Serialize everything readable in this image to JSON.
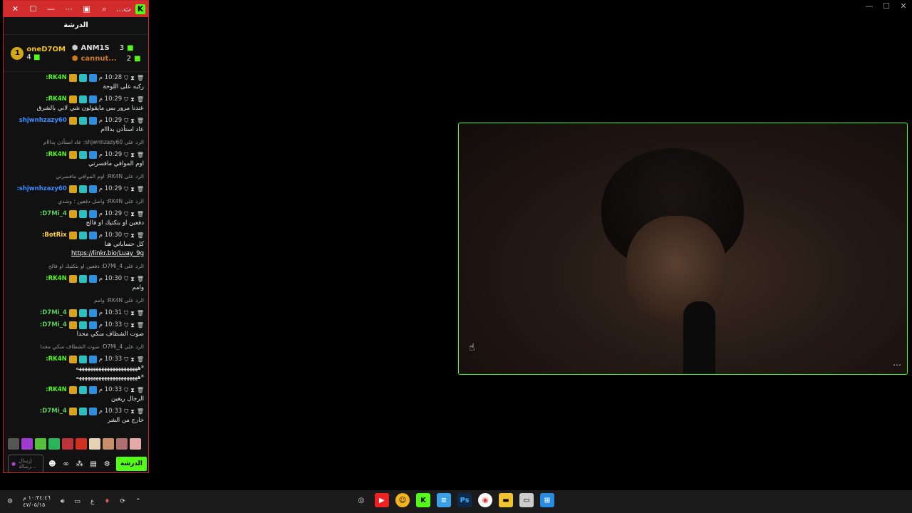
{
  "window_controls": [
    "—",
    "☐",
    "✕"
  ],
  "chat_window": {
    "title": "...ت",
    "header": "الدرشة",
    "leaderboard": {
      "first": {
        "rank": "1",
        "name": "oneD7OM",
        "count": "4"
      },
      "second": {
        "rank": "3",
        "name": "ANM1S"
      },
      "third": {
        "rank": "2",
        "name": "cannut..."
      }
    },
    "messages": [
      {
        "time": "10:28 م",
        "user": "RK4N:",
        "text": "ركبه على اللوحة",
        "ucls": "user-g"
      },
      {
        "time": "10:29 م",
        "user": "RK4N:",
        "text": "عندنا مرور بس مايقولون شي لاني بالشرق",
        "ucls": "user-g"
      },
      {
        "time": "10:29 م",
        "user": "shjwnhzazy60",
        "text": "عاد استأذن بدااام",
        "ucls": "user-b"
      },
      {
        "reply": "الرد على shjwnhzazy60: عاد استأذن بدااام"
      },
      {
        "time": "10:29 م",
        "user": "RK4N:",
        "text": "اوم الموافي مافسرتي",
        "ucls": "user-g"
      },
      {
        "reply": "الرد على RK4N: اوم الموافي مافسرتي"
      },
      {
        "time": "10:29 م",
        "user": "shjwnhzazy60:",
        "text": "",
        "ucls": "user-b"
      },
      {
        "reply": "الرد على RK4N: واصل دفعين ؛ وشدي"
      },
      {
        "time": "10:29 م",
        "user": "D7Mi_4:",
        "text": "دفعين او بتكتيك او فالح",
        "ucls": "user-gr"
      },
      {
        "time": "10:30 م",
        "user": "BotRix:",
        "text": "كل حساباتي هنا",
        "link": "https://linkr.bio/Luay_9g",
        "ucls": "user-y"
      },
      {
        "reply": "الرد على D7Mi_4: دفعين او بتكتيك او فالح"
      },
      {
        "time": "10:30 م",
        "user": "RK4N:",
        "text": "وامم",
        "ucls": "user-g"
      },
      {
        "reply": "الرد على RK4N: وامم"
      },
      {
        "time": "10:31 م",
        "user": "D7Mi_4:",
        "text": "",
        "ucls": "user-gr"
      },
      {
        "time": "10:33 م",
        "user": "D7Mi_4:",
        "text": "صوت الشطاف منكي محدا",
        "ucls": "user-gr"
      },
      {
        "reply": "الرد على D7Mi_4: صوت الشطاف منكي محدا"
      },
      {
        "time": "10:33 م",
        "user": "RK4N:",
        "text": "*ههههههههههههههههههههههه *ههههههههههههههههههههههه",
        "ucls": "user-g"
      },
      {
        "time": "10:33 م",
        "user": "RK4N:",
        "text": "الرجال ريغين",
        "ucls": "user-g"
      },
      {
        "time": "10:33 م",
        "user": "D7Mi_4:",
        "text": "خارج من الشر",
        "ucls": "user-gr"
      }
    ],
    "input_placeholder": "إرسال رسالة...",
    "chat_button": "الدرشة"
  },
  "taskbar": {
    "clock_time": "١٠:٣٤:٤٦ م",
    "clock_date": "٤٧/٠٥/١٥",
    "lang": "ع"
  },
  "colors": {
    "kick_green": "#53fc18",
    "title_red": "#d22c2c"
  }
}
